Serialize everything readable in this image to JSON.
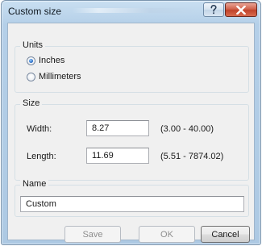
{
  "window": {
    "title": "Custom size"
  },
  "units": {
    "group_label": "Units",
    "options": [
      {
        "label": "Inches",
        "checked": true
      },
      {
        "label": "Millimeters",
        "checked": false
      }
    ]
  },
  "size": {
    "group_label": "Size",
    "width": {
      "label": "Width:",
      "value": "8.27",
      "range": "(3.00 - 40.00)"
    },
    "length": {
      "label": "Length:",
      "value": "11.69",
      "range": "(5.51 - 7874.02)"
    }
  },
  "name": {
    "group_label": "Name",
    "value": "Custom"
  },
  "buttons": {
    "save": "Save",
    "ok": "OK",
    "cancel": "Cancel"
  }
}
